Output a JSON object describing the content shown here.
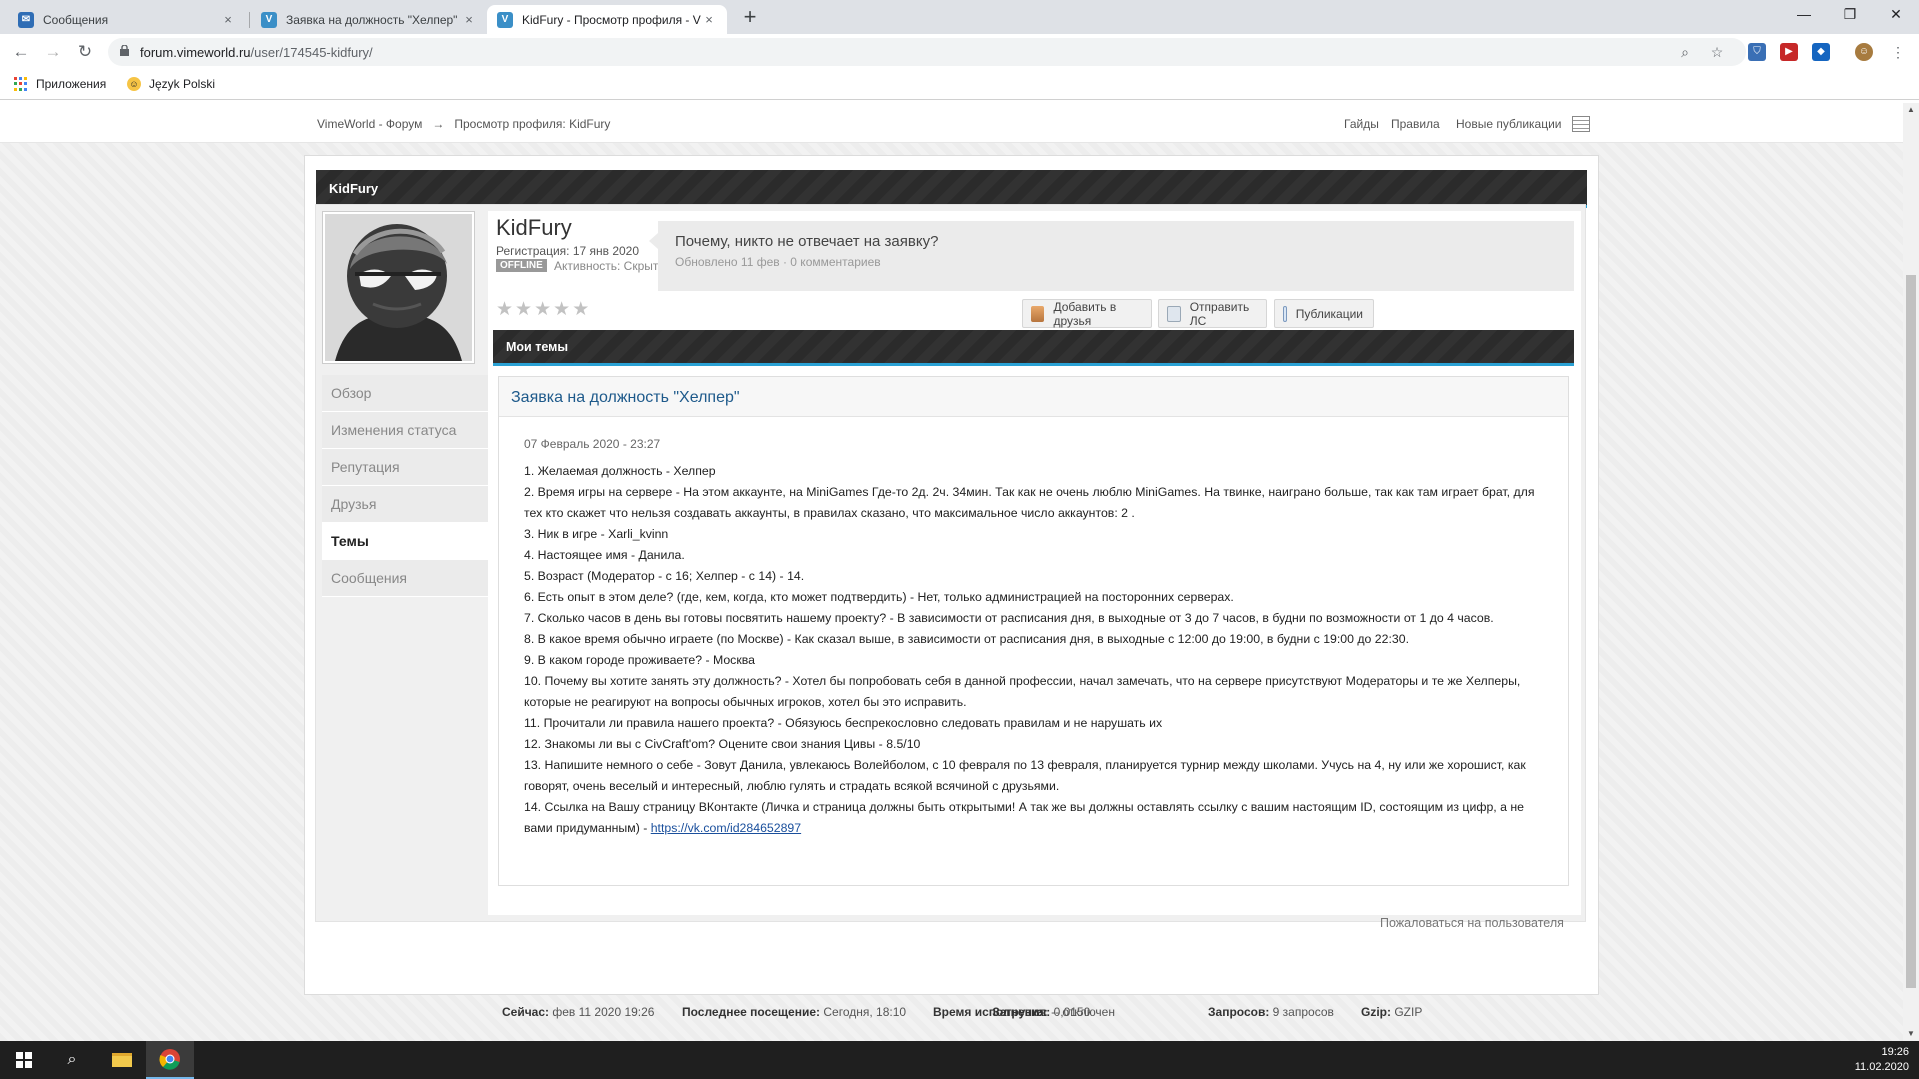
{
  "browser": {
    "tabs": [
      {
        "title": "Сообщения",
        "close": "×"
      },
      {
        "title": "Заявка на должность \"Хелпер\"",
        "close": "×"
      },
      {
        "title": "KidFury - Просмотр профиля - V",
        "close": "×"
      }
    ],
    "new_tab": "+",
    "url_host": "forum.vimeworld.ru",
    "url_path": "/user/174545-kidfury/",
    "bookmarks": [
      {
        "label": "Приложения"
      },
      {
        "label": "Język Polski"
      }
    ]
  },
  "forum": {
    "breadcrumb": {
      "home": "VimeWorld - Форум",
      "arrow": "→",
      "current": "Просмотр профиля: KidFury"
    },
    "top_links": [
      "Гайды",
      "Правила",
      "Новые публикации"
    ],
    "profile_header": "KidFury",
    "user": {
      "name": "KidFury",
      "registered": "Регистрация: 17 янв 2020",
      "status_badge": "OFFLINE",
      "activity": "Активность: Скрыто",
      "rating_stars": 5,
      "rating_filled": 0
    },
    "status_update": {
      "text": "Почему, никто не отвечает на заявку?",
      "meta": "Обновлено 11 фев · 0 комментариев"
    },
    "buttons": {
      "add_friend": "Добавить в друзья",
      "send_pm": "Отправить ЛС",
      "publications": "Публикации"
    },
    "sidenav": [
      {
        "label": "Обзор",
        "active": false
      },
      {
        "label": "Изменения статуса",
        "active": false
      },
      {
        "label": "Репутация",
        "active": false
      },
      {
        "label": "Друзья",
        "active": false
      },
      {
        "label": "Темы",
        "active": true
      },
      {
        "label": "Сообщения",
        "active": false
      }
    ],
    "my_topics_header": "Мои темы",
    "post": {
      "title": "Заявка на должность \"Хелпер\"",
      "date": "07 Февраль 2020 - 23:27",
      "lines": [
        "1. Желаемая должность - Хелпер",
        "2. Время игры на сервере - На этом аккаунте, на  MiniGames Где-то 2д. 2ч. 34мин. Так как не очень люблю MiniGames. На твинке, наиграно больше, так как там играет брат, для тех кто скажет что нельзя создавать аккаунты, в правилах сказано, что максимальное число аккаунтов: 2 .",
        "3. Ник в игре - Xarli_kvinn",
        "4. Настоящее имя - Данила.",
        "5. Возраст  (Модератор - с 16; Хелпер - с 14) - 14.",
        "6. Есть опыт в этом деле? (где, кем, когда, кто может подтвердить) - Нет, только администрацией на посторонних серверах.",
        "7. Сколько часов в день вы готовы посвятить нашему проекту? - В зависимости от расписания дня, в выходные от 3 до 7 часов, в будни по возможности от 1 до 4 часов.",
        "8. В какое время обычно играете (по Москве) - Как сказал выше, в зависимости от расписания  дня, в выходные с 12:00 до 19:00, в будни с 19:00 до 22:30.",
        "9. В каком городе проживаете? - Москва",
        "10. Почему вы хотите занять эту должность? - Хотел бы попробовать себя в данной профессии, начал замечать, что на сервере присутствуют Модераторы и те же Хелперы, которые не реагируют на вопросы обычных игроков, хотел бы это исправить.",
        "11. Прочитали ли правила нашего проекта? - Обязуюсь беспрекословно следовать правилам и не нарушать их",
        "12. Знакомы ли вы с CivCraft'om? Оцените свои знания Цивы - 8.5/10",
        "13. Напишите немного о себе - Зовут Данила, увлекаюсь Волейболом, с 10 февраля по 13 февраля, планируется турнир между школами. Учусь на 4, ну или же хорошист, как говорят, очень веселый и интересный, люблю гулять и страдать всякой всячиной с друзьями.",
        "14. Ссылка на Вашу страницу ВКонтакте (Личка и страница должны быть открытыми! А так же вы должны оставлять ссылку с вашим настоящим ID, состоящим из цифр, а не вами придуманным) - "
      ],
      "link_text": "https://vk.com/id284652897"
    },
    "complain": "Пожаловаться на пользователя",
    "footer": {
      "now_label": "Сейчас:",
      "now_value": "фев 11 2020 19:26",
      "last_label": "Последнее посещение:",
      "last_value": "Сегодня, 18:10",
      "exec_label": "Время исполнения:",
      "exec_value": "0,0150",
      "load_label": "Загрузка:",
      "load_value": "-- отключен",
      "queries_label": "Запросов:",
      "queries_value": "9 запросов",
      "gzip_label": "Gzip:",
      "gzip_value": "GZIP"
    }
  },
  "taskbar": {
    "time": "19:26",
    "date": "11.02.2020"
  }
}
